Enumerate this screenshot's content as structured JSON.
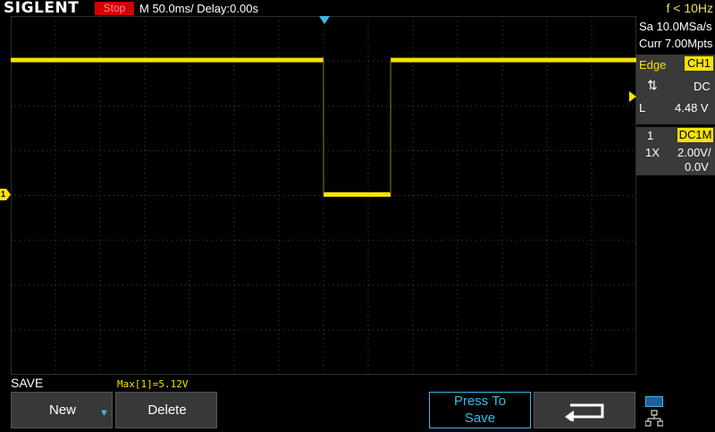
{
  "header": {
    "logo": "SIGLENT",
    "run_status": "Stop",
    "timebase": "M 50.0ms/ Delay:0.00s",
    "frequency": "f < 10Hz"
  },
  "acquisition": {
    "sample_rate": "Sa 10.0MSa/s",
    "memory_depth": "Curr 7.00Mpts"
  },
  "trigger": {
    "type": "Edge",
    "source": "CH1",
    "slope_icon": "rising-falling-edge-icon",
    "coupling": "DC",
    "level_label": "L",
    "level": "4.48 V"
  },
  "channel": {
    "number": "1",
    "coupling": "DC1M",
    "probe": "1X",
    "volts_per_div": "2.00V/",
    "offset": "0.0V",
    "ground_marker": "1"
  },
  "measurement": "Max[1]=5.12V",
  "menu": {
    "title": "SAVE",
    "new_label": "New",
    "delete_label": "Delete",
    "save_label_line1": "Press To",
    "save_label_line2": "Save",
    "back_icon": "return-arrow-icon",
    "status_icons": [
      "usb-storage-icon",
      "network-icon"
    ]
  },
  "colors": {
    "trace": "#f5e300",
    "accent": "#3fb9e8",
    "stop": "#d40000"
  },
  "chart_data": {
    "type": "line",
    "units": {
      "x": "s",
      "y": "V"
    },
    "series": [
      {
        "x": [
          -0.35,
          -0.0001,
          0.0,
          0.075,
          0.0751,
          0.35
        ],
        "y": [
          5.0,
          5.0,
          0.0,
          0.0,
          5.0,
          5.0
        ]
      }
    ]
  }
}
